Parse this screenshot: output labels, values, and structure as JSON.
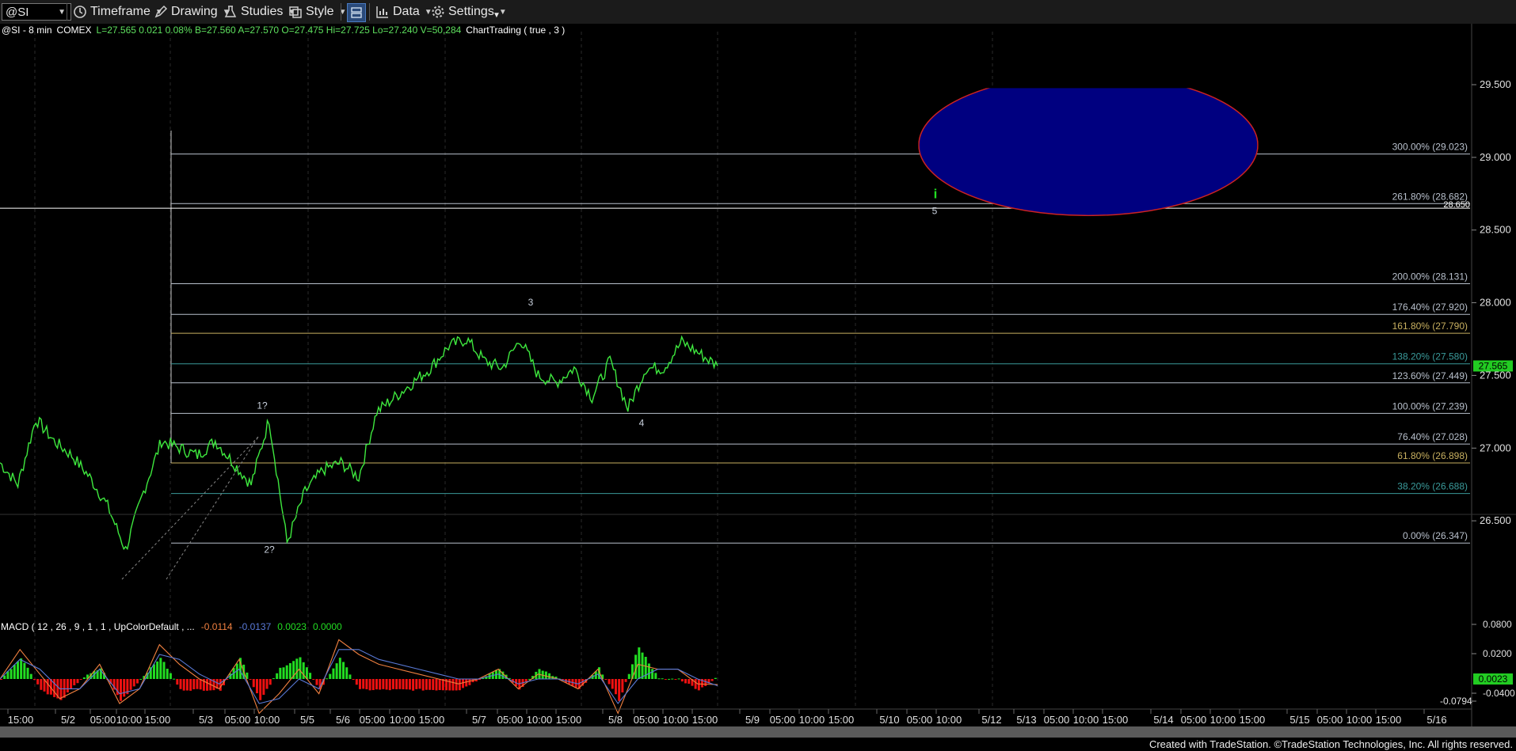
{
  "toolbar": {
    "symbol": "@SI",
    "timeframe_label": "Timeframe",
    "drawing_label": "Drawing",
    "studies_label": "Studies",
    "style_label": "Style",
    "data_label": "Data",
    "settings_label": "Settings"
  },
  "header": {
    "symbol": "@SI - 8 min",
    "exchange": "COMEX",
    "quote": "L=27.565  0.021  0.08%  B=27.560  A=27.570  O=27.475  Hi=27.725  Lo=27.240  V=50,284",
    "chart_trading": "ChartTrading ( true , 3 )"
  },
  "macd_header": {
    "label": "MACD ( 12 , 26 , 9 , 1 , 1 , UpColorDefault , ...",
    "v1": "-0.0114",
    "v2": "-0.0137",
    "v3": "0.0023",
    "v4": "0.0000"
  },
  "footer": {
    "credit": "Created with TradeStation. ©TradeStation Technologies, Inc. All rights reserved."
  },
  "colors": {
    "background": "#000000",
    "price": "#3ee83e",
    "fib_line": "#b8c0cc",
    "fib_gold": "#c8b060",
    "fib_teal": "#3a9a9a",
    "target_fill": "#000080",
    "target_stroke": "#cc2222",
    "last_price_bg": "#22cc22",
    "macd_up": "#22dd22",
    "macd_down": "#ee1111",
    "macd_line": "#f08040",
    "signal_line": "#5a7ad8"
  },
  "chart_data": {
    "type": "line",
    "title": "@SI - 8 min",
    "yaxis_ticks": [
      "29.500",
      "29.000",
      "28.500",
      "28.000",
      "27.500",
      "27.000",
      "26.500"
    ],
    "last_price": "27.565",
    "ylim": [
      26.08,
      29.63
    ],
    "xaxis_labels": [
      "15:00",
      "5/2",
      "05:00",
      "10:00",
      "15:00",
      "5/3",
      "05:00",
      "10:00",
      "5/5",
      "5/6",
      "05:00",
      "10:00",
      "15:00",
      "5/7",
      "05:00",
      "10:00",
      "15:00",
      "5/8",
      "05:00",
      "10:00",
      "15:00",
      "5/9",
      "05:00",
      "10:00",
      "15:00",
      "5/10",
      "05:00",
      "10:00",
      "5/12",
      "5/13",
      "05:00",
      "10:00",
      "15:00",
      "5/14",
      "05:00",
      "10:00",
      "15:00",
      "5/15",
      "05:00",
      "10:00",
      "15:00",
      "5/16"
    ],
    "price_series": {
      "name": "@SI",
      "values": [
        26.9,
        26.75,
        27.2,
        27.05,
        26.95,
        26.8,
        26.6,
        26.3,
        26.7,
        27.05,
        27.0,
        26.95,
        27.05,
        26.9,
        26.75,
        27.2,
        26.35,
        26.7,
        26.85,
        26.9,
        26.8,
        27.25,
        27.35,
        27.45,
        27.55,
        27.7,
        27.75,
        27.6,
        27.55,
        27.75,
        27.5,
        27.45,
        27.55,
        27.35,
        27.6,
        27.27,
        27.55,
        27.55,
        27.73,
        27.65,
        27.565
      ]
    },
    "fib_levels": [
      {
        "label": "300.00% (29.023)",
        "value": 29.023
      },
      {
        "label": "261.80% (28.682)",
        "value": 28.682
      },
      {
        "label": "200.00% (28.131)",
        "value": 28.131
      },
      {
        "label": "176.40% (27.920)",
        "value": 27.92
      },
      {
        "label": "161.80% (27.790)",
        "value": 27.79
      },
      {
        "label": "138.20% (27.580)",
        "value": 27.58
      },
      {
        "label": "123.60% (27.449)",
        "value": 27.449
      },
      {
        "label": "100.00% (27.239)",
        "value": 27.239
      },
      {
        "label": "76.40% (27.028)",
        "value": 27.028
      },
      {
        "label": "61.80% (26.898)",
        "value": 26.898
      },
      {
        "label": "38.20% (26.688)",
        "value": 26.688
      },
      {
        "label": "0.00% (26.347)",
        "value": 26.347
      }
    ],
    "horizontal_line": {
      "label": "28.650",
      "value": 28.65
    },
    "wave_labels": [
      {
        "text": "1?",
        "value": 27.27
      },
      {
        "text": "2?",
        "value": 26.28
      },
      {
        "text": "3",
        "value": 27.98
      },
      {
        "text": "4",
        "value": 27.15
      },
      {
        "text": "5",
        "value": 28.61
      },
      {
        "text": "i",
        "value": 28.72
      }
    ],
    "target_zone": {
      "low": 28.6,
      "high": 29.57
    },
    "macd": {
      "yaxis_ticks": [
        "0.0800",
        "0.0200",
        "0.0023",
        "-0.0400",
        "-0.0794"
      ],
      "macd": [
        0.0,
        0.06,
        0.01,
        -0.04,
        -0.02,
        0.03,
        -0.05,
        -0.02,
        0.07,
        0.03,
        0.0,
        -0.02,
        0.04,
        -0.07,
        -0.03,
        0.02,
        -0.03,
        0.08,
        0.05,
        0.03,
        0.02,
        0.01,
        0.0,
        -0.01,
        0.0,
        0.02,
        -0.02,
        0.01,
        0.0,
        -0.02,
        0.02,
        -0.07,
        0.03,
        0.02,
        0.02,
        -0.01,
        -0.0114
      ],
      "signal": [
        0.0,
        0.04,
        0.02,
        -0.02,
        -0.02,
        0.02,
        -0.03,
        -0.02,
        0.05,
        0.04,
        0.01,
        -0.01,
        0.02,
        -0.05,
        -0.04,
        0.0,
        -0.02,
        0.06,
        0.06,
        0.04,
        0.03,
        0.02,
        0.01,
        0.0,
        0.0,
        0.01,
        -0.01,
        0.0,
        0.0,
        -0.01,
        0.01,
        -0.05,
        0.0,
        0.02,
        0.02,
        0.0,
        -0.0137
      ]
    }
  }
}
